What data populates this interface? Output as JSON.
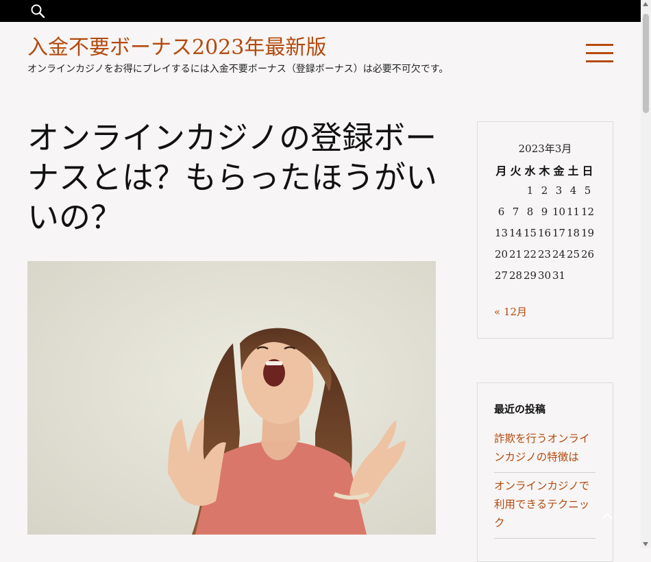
{
  "topbar": {
    "search_icon": "search-icon"
  },
  "site": {
    "title": "入金不要ボーナス2023年最新版",
    "tagline": "オンラインカジノをお得にプレイするには入金不要ボーナス（登録ボーナス）は必要不可欠です。",
    "menu_icon": "hamburger-menu-icon"
  },
  "post": {
    "title": "オンラインカジノの登録ボーナスとは？もらったほうがいいの？",
    "image_icon": "woman-celebrating-photo"
  },
  "calendar": {
    "caption": "2023年3月",
    "weekdays": [
      "月",
      "火",
      "水",
      "木",
      "金",
      "土",
      "日"
    ],
    "weeks": [
      [
        "",
        "",
        "1",
        "2",
        "3",
        "4",
        "5"
      ],
      [
        "6",
        "7",
        "8",
        "9",
        "10",
        "11",
        "12"
      ],
      [
        "13",
        "14",
        "15",
        "16",
        "17",
        "18",
        "19"
      ],
      [
        "20",
        "21",
        "22",
        "23",
        "24",
        "25",
        "26"
      ],
      [
        "27",
        "28",
        "29",
        "30",
        "31",
        "",
        ""
      ]
    ],
    "prev_link": "« 12月"
  },
  "recent_posts": {
    "title": "最近の投稿",
    "items": [
      "詐欺を行うオンラインカジノの特徴は",
      "オンラインカジノで利用できるテクニック"
    ]
  },
  "colors": {
    "accent": "#b34a0e",
    "topbar": "#000000",
    "background": "#f7f5f5"
  },
  "back_to_top_icon": "chevron-up-icon"
}
